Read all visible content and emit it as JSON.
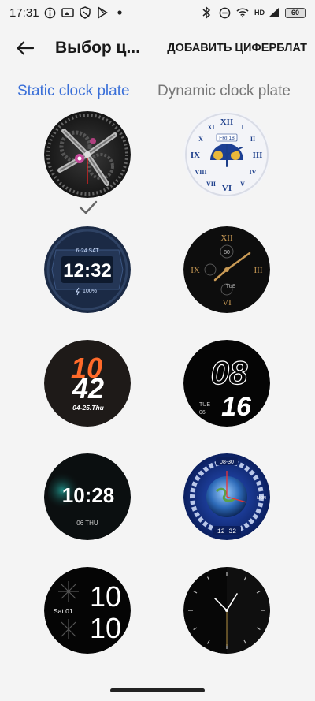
{
  "status_bar": {
    "time": "17:31",
    "network": "HD",
    "battery": "60"
  },
  "app_bar": {
    "title": "Выбор ц...",
    "add_button": "ДОБАВИТЬ ЦИФЕРБЛАТ"
  },
  "tabs": [
    {
      "label": "Static clock plate",
      "active": true
    },
    {
      "label": "Dynamic clock plate",
      "active": false
    }
  ],
  "faces": {
    "f1": {
      "name": "mechanical-gear-face",
      "selected": true
    },
    "f2": {
      "name": "roman-moonphase-face",
      "date": "FRI 18"
    },
    "f3": {
      "name": "digital-panel-face",
      "date": "6-24 SAT",
      "time": "12:32",
      "battery": "100%"
    },
    "f4": {
      "name": "black-gold-face",
      "top": "XII",
      "left": "IX",
      "right": "III",
      "bottom": "VI",
      "num": "80",
      "day": "TUE"
    },
    "f5": {
      "name": "orange-digital-face",
      "hour": "10",
      "minute": "42",
      "date": "04-25.Thu"
    },
    "f6": {
      "name": "outline-number-face",
      "hour": "08",
      "minute": "16",
      "day": "TUE",
      "date": "06"
    },
    "f7": {
      "name": "teal-digital-face",
      "time": "10:28",
      "date": "06 THU"
    },
    "f8": {
      "name": "earth-face",
      "date": "08-30",
      "day": "MON",
      "time": "12 32"
    },
    "f9": {
      "name": "vertical-digits-face",
      "date": "Sat 01",
      "hour": "10",
      "minute": "10"
    },
    "f10": {
      "name": "minimal-analog-face"
    }
  },
  "colors": {
    "accent": "#3a6fd8",
    "orange": "#ff6a2a",
    "teal": "#3fd6c8",
    "gold": "#c99a55"
  }
}
